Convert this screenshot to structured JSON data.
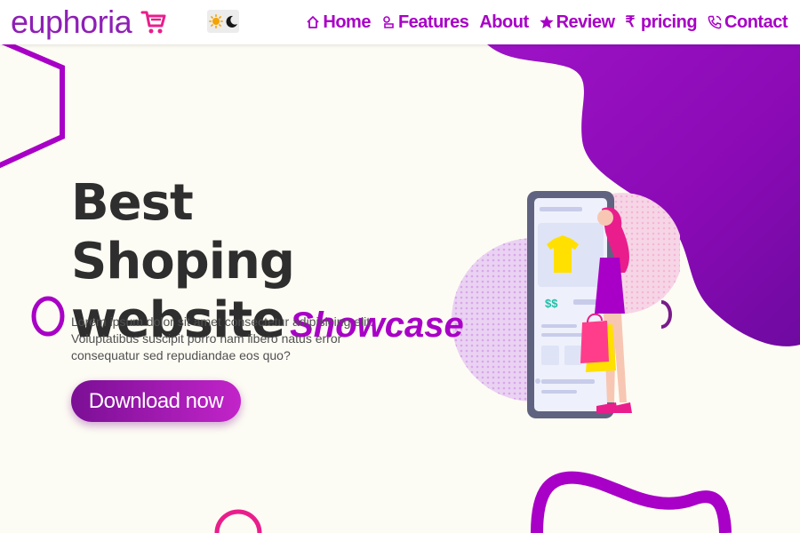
{
  "brand": {
    "name": "euphoria",
    "cart_icon": "cart-icon"
  },
  "theme_toggle": {
    "icons": [
      "sun-icon",
      "moon-icon"
    ]
  },
  "nav": {
    "items": [
      {
        "label": "Home",
        "icon": "home-icon"
      },
      {
        "label": "Features",
        "icon": "features-icon"
      },
      {
        "label": "About",
        "icon": ""
      },
      {
        "label": "Review",
        "icon": "star-icon"
      },
      {
        "label": "pricing",
        "icon": "rupee-icon",
        "symbol": "₹"
      },
      {
        "label": "Contact",
        "icon": "phone-icon"
      }
    ]
  },
  "hero": {
    "title_line1": "Best Shoping",
    "title_line2": "website",
    "title_accent": "Showcase",
    "description": "Lorem ipsum dolor sit amet consectetur adipisicing elit. Voluptatibus suscipit porro nam libero natus error consequatur sed repudiandae eos quo?",
    "cta_label": "Download now"
  },
  "illustration": {
    "price_text": "$$"
  },
  "colors": {
    "accent": "#a800c6",
    "brand": "#8e1fb5",
    "background": "#fdfcf4",
    "blob": "#9c0fc4",
    "pink": "#e91e8c"
  }
}
